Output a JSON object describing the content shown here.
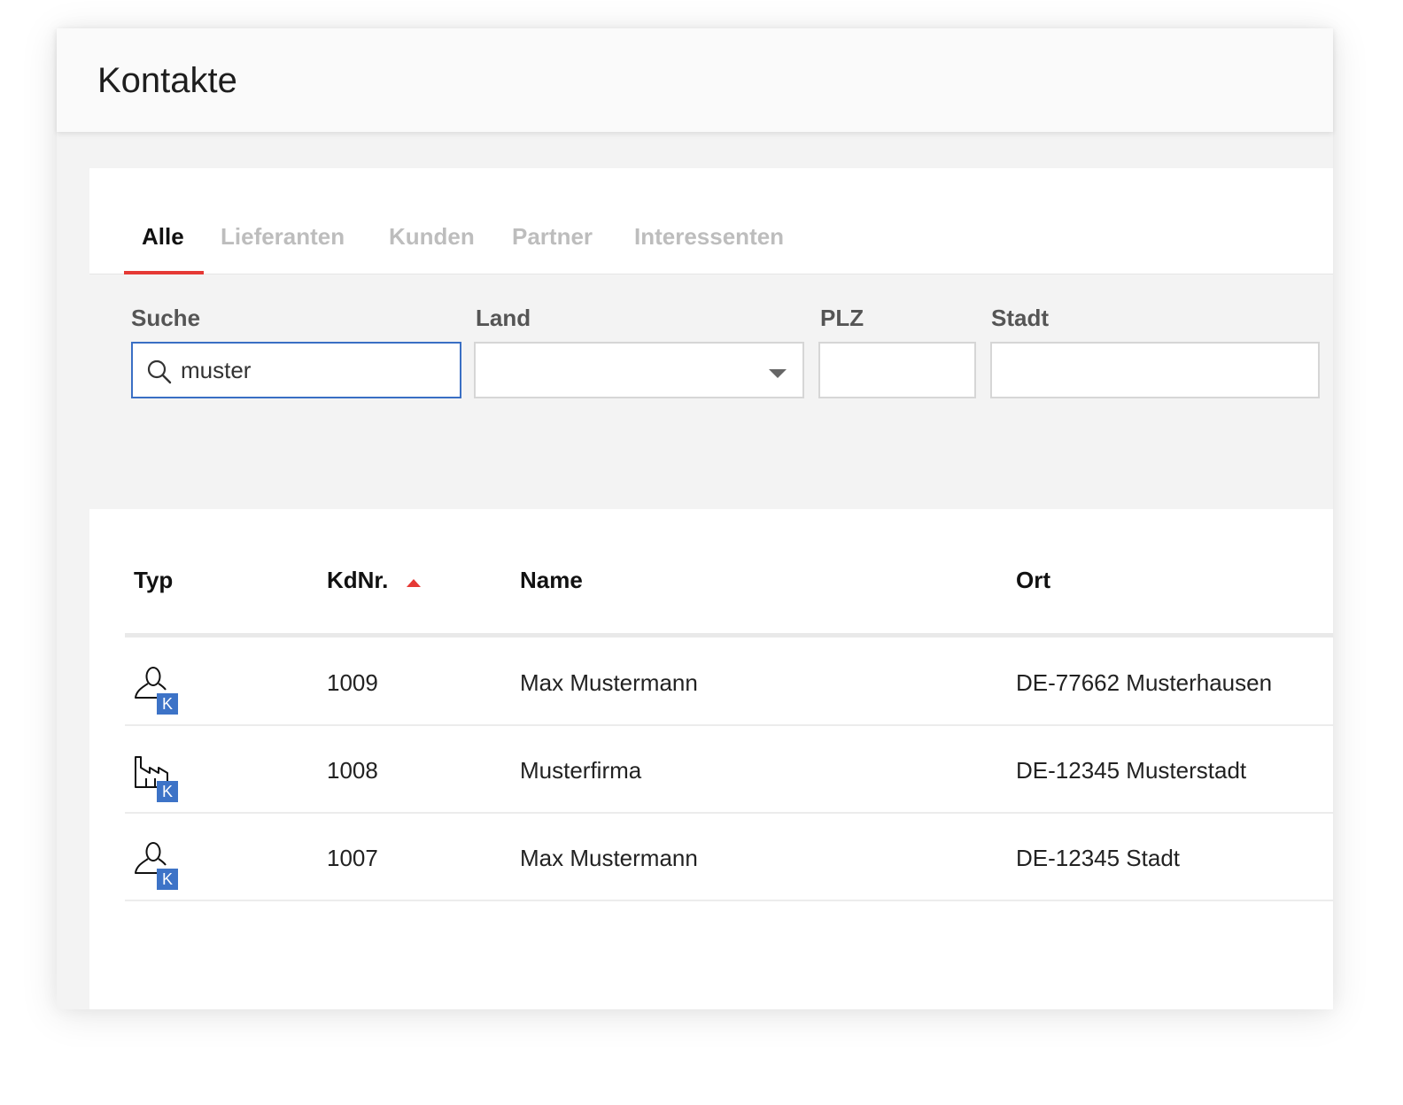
{
  "app": {
    "title": "Kontakte"
  },
  "tabs": [
    {
      "label": "Alle",
      "active": true
    },
    {
      "label": "Lieferanten",
      "active": false
    },
    {
      "label": "Kunden",
      "active": false
    },
    {
      "label": "Partner",
      "active": false
    },
    {
      "label": "Interessenten",
      "active": false
    }
  ],
  "filters": {
    "search": {
      "label": "Suche",
      "value": "muster",
      "icon": "search-icon"
    },
    "country": {
      "label": "Land",
      "value": "",
      "icon": "chevron-down-icon"
    },
    "zip": {
      "label": "PLZ",
      "value": ""
    },
    "city": {
      "label": "Stadt",
      "value": ""
    }
  },
  "table": {
    "columns": {
      "typ": "Typ",
      "kdnr": "KdNr.",
      "name": "Name",
      "ort": "Ort"
    },
    "sort": {
      "column": "kdnr",
      "direction": "ascending-icon"
    },
    "rows": [
      {
        "type_icon": "person-icon",
        "badge": "K",
        "kdnr": "1009",
        "name": "Max Mustermann",
        "ort": "DE-77662 Musterhausen"
      },
      {
        "type_icon": "company-icon",
        "badge": "K",
        "kdnr": "1008",
        "name": "Musterfirma",
        "ort": "DE-12345 Musterstadt"
      },
      {
        "type_icon": "person-icon",
        "badge": "K",
        "kdnr": "1007",
        "name": "Max Mustermann",
        "ort": "DE-12345 Stadt"
      }
    ]
  },
  "colors": {
    "accent": "#e53935",
    "focus": "#3a6fc4",
    "badge": "#3d73c7"
  }
}
